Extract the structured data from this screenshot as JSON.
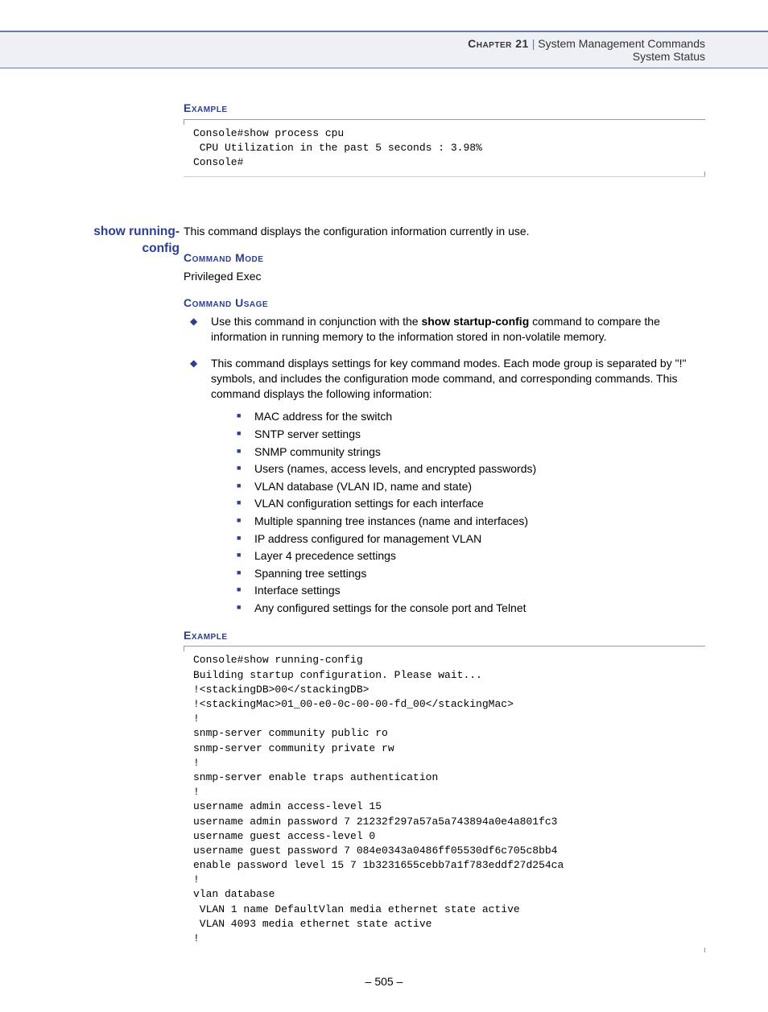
{
  "header": {
    "chapter_label": "Chapter 21",
    "separator": "  |  ",
    "title": "System Management Commands",
    "subtitle": "System Status"
  },
  "section1": {
    "heading": "Example",
    "code": "Console#show process cpu\n CPU Utilization in the past 5 seconds : 3.98%\nConsole#"
  },
  "command": {
    "name": "show running-config",
    "description": "This command displays the configuration information currently in use.",
    "mode_heading": "Command Mode",
    "mode_value": "Privileged Exec",
    "usage_heading": "Command Usage",
    "usage": {
      "item1_pre": "Use this command in conjunction with the ",
      "item1_bold": "show startup-config",
      "item1_post": " command to compare the information in running memory to the information stored in non-volatile memory.",
      "item2": "This command displays settings for key command modes. Each mode group is separated by \"!\" symbols, and includes the configuration mode command, and corresponding commands. This command displays the following information:",
      "sublist": [
        "MAC address for the switch",
        "SNTP server settings",
        "SNMP community strings",
        "Users (names, access levels, and encrypted passwords)",
        "VLAN database (VLAN ID, name and state)",
        "VLAN configuration settings for each interface",
        "Multiple spanning tree instances (name and interfaces)",
        "IP address configured for management VLAN",
        "Layer 4 precedence settings",
        "Spanning tree settings",
        "Interface settings",
        "Any configured settings for the console port and Telnet"
      ]
    },
    "example_heading": "Example",
    "example_code": "Console#show running-config\nBuilding startup configuration. Please wait...\n!<stackingDB>00</stackingDB>\n!<stackingMac>01_00-e0-0c-00-00-fd_00</stackingMac>\n!\nsnmp-server community public ro\nsnmp-server community private rw\n!\nsnmp-server enable traps authentication\n!\nusername admin access-level 15\nusername admin password 7 21232f297a57a5a743894a0e4a801fc3\nusername guest access-level 0\nusername guest password 7 084e0343a0486ff05530df6c705c8bb4\nenable password level 15 7 1b3231655cebb7a1f783eddf27d254ca\n!\nvlan database\n VLAN 1 name DefaultVlan media ethernet state active\n VLAN 4093 media ethernet state active\n!"
  },
  "footer": {
    "page": "–  505  –"
  }
}
